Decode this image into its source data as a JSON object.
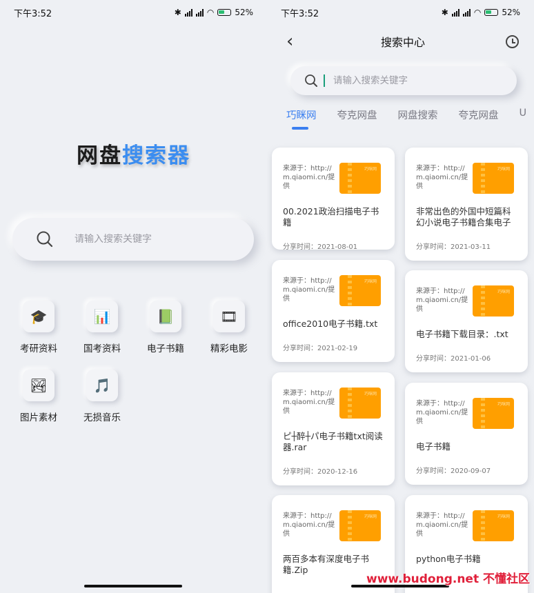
{
  "left": {
    "status": {
      "time": "下午3:52",
      "battery": "52%"
    },
    "brand": {
      "part1": "网盘",
      "part2": "搜索器"
    },
    "search": {
      "placeholder": "请输入搜索关键字"
    },
    "grid": [
      {
        "label": "考研资料",
        "icon": "graduation-cap-icon",
        "glyph": "🎓"
      },
      {
        "label": "国考资料",
        "icon": "monitor-chart-icon",
        "glyph": "📊"
      },
      {
        "label": "电子书籍",
        "icon": "ebook-icon",
        "glyph": "📗"
      },
      {
        "label": "精彩电影",
        "icon": "film-reel-icon",
        "glyph": "🎞"
      },
      {
        "label": "图片素材",
        "icon": "landscape-image-icon",
        "glyph": "🏞"
      },
      {
        "label": "无损音乐",
        "icon": "music-note-icon",
        "glyph": "🎵"
      }
    ]
  },
  "right": {
    "status": {
      "time": "下午3:52",
      "battery": "52%"
    },
    "header": {
      "title": "搜索中心"
    },
    "search": {
      "placeholder": "请输入搜索关键字"
    },
    "tabs": [
      "巧眯网",
      "夸克网盘",
      "网盘搜索",
      "夸克网盘",
      "U"
    ],
    "active_tab": 0,
    "cards_left": [
      {
        "source": "来源于：http://m.qiaomi.cn/提供",
        "title": "00.2021政治扫描电子书籍",
        "date": "分享时间：2021-08-01"
      },
      {
        "source": "来源于：http://m.qiaomi.cn/提供",
        "title": "office2010电子书籍.txt",
        "date": "分享时间：2021-02-19"
      },
      {
        "source": "来源于：http://m.qiaomi.cn/提供",
        "title": "ピ┼醉┼パ电子书籍txt阅读器.rar",
        "date": "分享时间：2020-12-16"
      },
      {
        "source": "来源于：http://m.qiaomi.cn/提供",
        "title": "两百多本有深度电子书籍.Zip",
        "date": ""
      }
    ],
    "cards_right": [
      {
        "source": "来源于：http://m.qiaomi.cn/提供",
        "title": "非常出色的外国中短篇科幻小说电子书籍合集电子书…",
        "date": "分享时间：2021-03-11"
      },
      {
        "source": "来源于：http://m.qiaomi.cn/提供",
        "title": "电子书籍下载目录：.txt",
        "date": "分享时间：2021-01-06"
      },
      {
        "source": "来源于：http://m.qiaomi.cn/提供",
        "title": "电子书籍",
        "date": "分享时间：2020-09-07"
      },
      {
        "source": "来源于：http://m.qiaomi.cn/提供",
        "title": "python电子书籍",
        "date": ""
      }
    ],
    "thumb_tag": "巧咪网"
  },
  "watermark": "www.budong.net 不懂社区"
}
